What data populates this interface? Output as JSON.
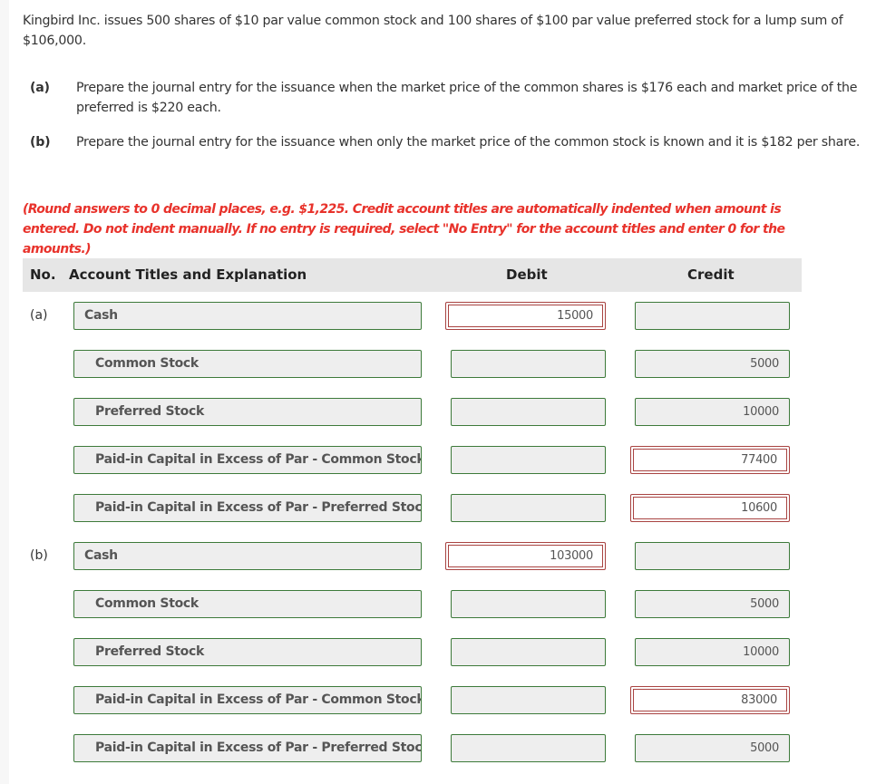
{
  "problem": {
    "intro": "Kingbird Inc. issues 500 shares of $10 par value common stock and 100 shares of $100 par value preferred stock for a lump sum of $106,000.",
    "parts": [
      {
        "label": "(a)",
        "text": "Prepare the journal entry for the issuance when the market price of the common shares is $176 each and market price of the preferred is $220 each."
      },
      {
        "label": "(b)",
        "text": "Prepare the journal entry for the issuance when only the market price of the common stock is known and it is $182 per share."
      }
    ],
    "note": "(Round answers to 0 decimal places, e.g. $1,225. Credit account titles are automatically indented when amount is entered. Do not indent manually. If no entry is required, select \"No Entry\" for the account titles and enter 0 for the amounts.)"
  },
  "table": {
    "headers": {
      "no": "No.",
      "account": "Account Titles and Explanation",
      "debit": "Debit",
      "credit": "Credit"
    },
    "entries": [
      {
        "label": "(a)",
        "rows": [
          {
            "account": "Cash",
            "debit": "15000",
            "credit": "",
            "debit_status": "incorrect",
            "credit_status": "correct",
            "indent": false
          },
          {
            "account": "Common Stock",
            "debit": "",
            "credit": "5000",
            "debit_status": "correct",
            "credit_status": "correct",
            "indent": true
          },
          {
            "account": "Preferred Stock",
            "debit": "",
            "credit": "10000",
            "debit_status": "correct",
            "credit_status": "correct",
            "indent": true
          },
          {
            "account": "Paid-in Capital in Excess of Par - Common Stock",
            "debit": "",
            "credit": "77400",
            "debit_status": "correct",
            "credit_status": "incorrect",
            "indent": true
          },
          {
            "account": "Paid-in Capital in Excess of Par - Preferred Stock",
            "debit": "",
            "credit": "10600",
            "debit_status": "correct",
            "credit_status": "incorrect",
            "indent": true
          }
        ]
      },
      {
        "label": "(b)",
        "rows": [
          {
            "account": "Cash",
            "debit": "103000",
            "credit": "",
            "debit_status": "incorrect",
            "credit_status": "correct",
            "indent": false
          },
          {
            "account": "Common Stock",
            "debit": "",
            "credit": "5000",
            "debit_status": "correct",
            "credit_status": "correct",
            "indent": true
          },
          {
            "account": "Preferred Stock",
            "debit": "",
            "credit": "10000",
            "debit_status": "correct",
            "credit_status": "correct",
            "indent": true
          },
          {
            "account": "Paid-in Capital in Excess of Par - Common Stock",
            "debit": "",
            "credit": "83000",
            "debit_status": "correct",
            "credit_status": "incorrect",
            "indent": true
          },
          {
            "account": "Paid-in Capital in Excess of Par - Preferred Stock",
            "debit": "",
            "credit": "5000",
            "debit_status": "correct",
            "credit_status": "correct",
            "indent": true
          }
        ]
      }
    ]
  },
  "colors": {
    "correct_border": "#3d7a3a",
    "incorrect_border": "#a94442",
    "note_text": "#e8322b",
    "header_bg": "#e6e6e6"
  }
}
